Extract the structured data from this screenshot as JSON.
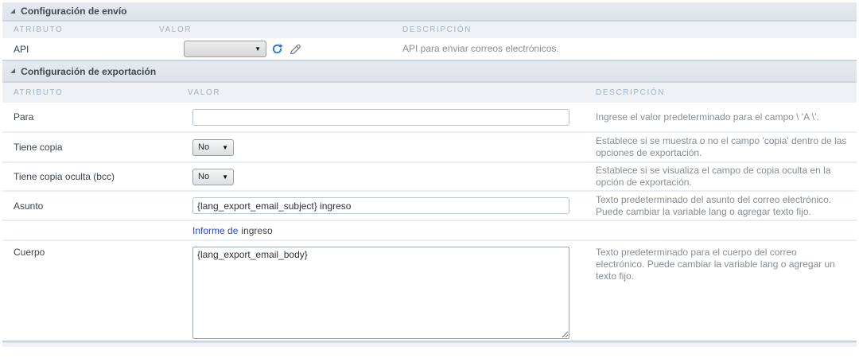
{
  "section_send": {
    "title": "Configuración de envío",
    "col_attribute": "ATRIBUTO",
    "col_value": "VALOR",
    "col_description": "DESCRIPCIÓN",
    "api_row": {
      "label": "API",
      "select_value": "",
      "description": "API para enviar correos electrónicos."
    }
  },
  "section_export": {
    "title": "Configuración de exportación",
    "col_attribute": "ATRIBUTO",
    "col_value": "VALOR",
    "col_description": "DESCRIPCIÓN",
    "rows": {
      "para": {
        "label": "Para",
        "value": "",
        "description": "Ingrese el valor predeterminado para el campo \\ 'A \\'."
      },
      "cc": {
        "label": "Tiene copia",
        "value": "No",
        "description": "Establece si se muestra o no el campo 'copia' dentro de las opciones de exportación."
      },
      "bcc": {
        "label": "Tiene copia oculta (bcc)",
        "value": "No",
        "description": "Establece si se visualiza el campo de copia oculta en la opción de exportación."
      },
      "subject": {
        "label": "Asunto",
        "value": "{lang_export_email_subject} ingreso",
        "description": "Texto predeterminado del asunto del correo electrónico. Puede cambiar la variable lang o agregar texto fijo."
      },
      "report": {
        "link_label": "Informe de",
        "suffix": "ingreso"
      },
      "body": {
        "label": "Cuerpo",
        "value": "{lang_export_email_body}",
        "description": "Texto predeterminado para el cuerpo del correo electrónico. Puede cambiar la variable lang o agregar un texto fijo."
      }
    }
  },
  "icons": {
    "collapse": "◢",
    "select_arrow": "▼"
  },
  "colors": {
    "link": "#2b46d9",
    "refresh_icon": "#2b7de0"
  }
}
